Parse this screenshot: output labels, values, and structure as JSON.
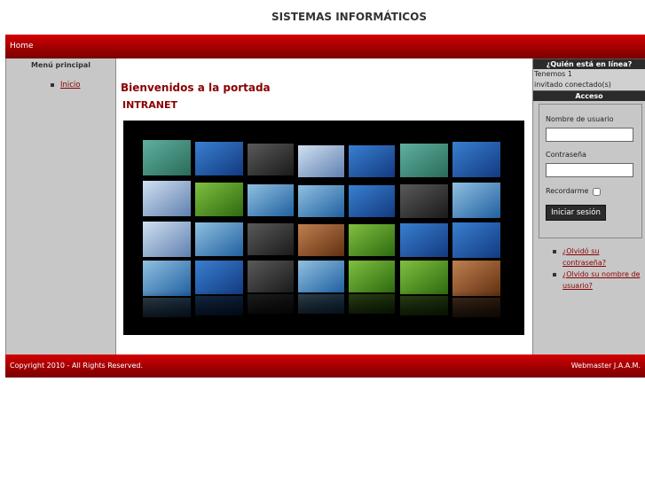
{
  "site_title": "SISTEMAS INFORMÁTICOS",
  "topnav": {
    "home": "Home"
  },
  "left_menu": {
    "title": "Menú principal",
    "items": [
      {
        "label": "Inicio"
      }
    ]
  },
  "main": {
    "heading": "Bienvenidos a la portada",
    "subheading": "INTRANET"
  },
  "who_online": {
    "title": "¿Quién está en línea?",
    "line1": "Tenemos 1",
    "line2": "invitado conectado(s)"
  },
  "login": {
    "title": "Acceso",
    "username_label": "Nombre de usuario",
    "password_label": "Contraseña",
    "remember_label": "Recordarme",
    "submit_label": "Iniciar sesión",
    "forgot_password": "¿Olvidó su contraseña?",
    "forgot_username": "¿Olvido su nombre de usuario?"
  },
  "footer": {
    "copyright": "Copyright 2010 - All Rights Reserved.",
    "webmaster": "Webmaster J.A.A.M."
  },
  "colors": {
    "brand_red": "#b00000",
    "link_red": "#8b0000",
    "sidebar_gray": "#c7c7c7"
  }
}
